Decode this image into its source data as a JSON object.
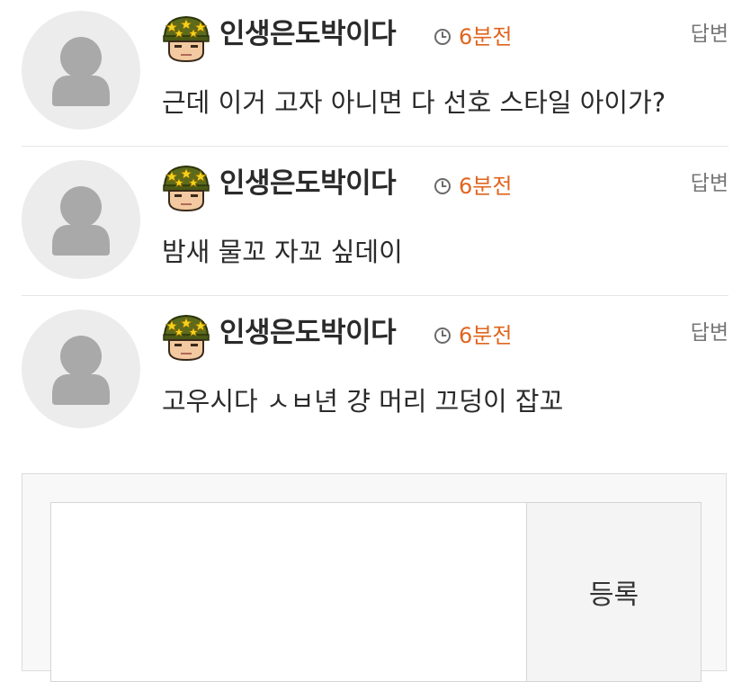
{
  "comments": [
    {
      "author": "인생은도박이다",
      "rank_icon": "rank-soldier-icon",
      "time": "6분전",
      "reply_label": "답변",
      "body": "근데 이거 고자 아니면 다 선호 스타일 아이가?"
    },
    {
      "author": "인생은도박이다",
      "rank_icon": "rank-soldier-icon",
      "time": "6분전",
      "reply_label": "답변",
      "body": "밤새 물꼬 자꼬 싶데이"
    },
    {
      "author": "인생은도박이다",
      "rank_icon": "rank-soldier-icon",
      "time": "6분전",
      "reply_label": "답변",
      "body": "고우시다 ㅅㅂ년 걍 머리 끄덩이 잡꼬"
    }
  ],
  "comment_form": {
    "input_value": "",
    "submit_label": "등록"
  },
  "colors": {
    "time": "#e0651e",
    "avatar_bg": "#ececec",
    "avatar_fg": "#a9a9a9",
    "divider": "#e6e6e6",
    "text": "#2a2a2a",
    "reply": "#777777"
  }
}
